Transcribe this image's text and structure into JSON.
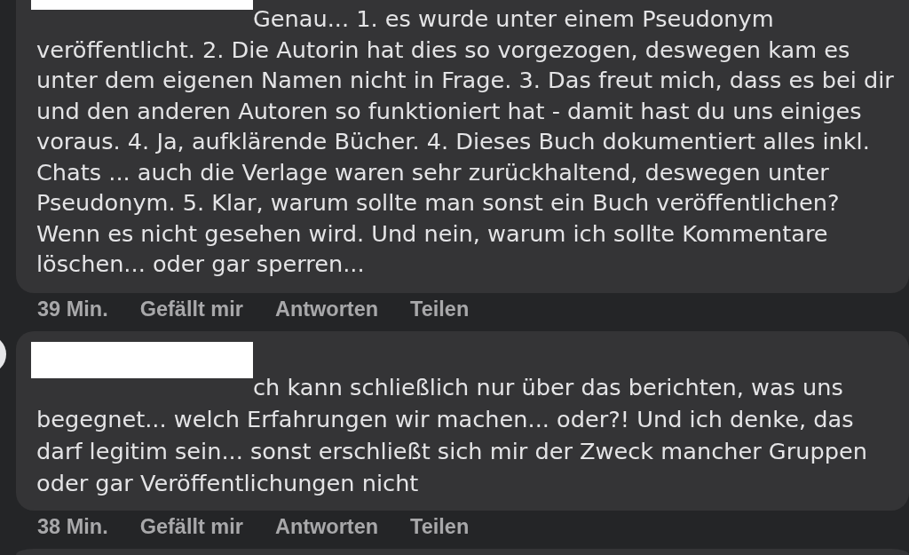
{
  "comments": [
    {
      "avatar": false,
      "text": "Genau... 1. es wurde unter einem Pseudonym veröffentlicht. 2. Die Autorin hat dies so vorgezogen, deswegen kam es unter dem eigenen Namen nicht in Frage. 3. Das freut mich, dass es bei dir und den anderen Autoren so funktioniert hat - damit hast du uns einiges voraus. 4. Ja, aufklärende Bücher. 4. Dieses Buch dokumentiert alles inkl. Chats ... auch die Verlage waren sehr zurückhaltend, deswegen unter Pseudonym. 5. Klar, warum sollte man sonst ein Buch veröffentlichen? Wenn es nicht gesehen wird. Und nein, warum ich sollte Kommentare löschen... oder gar sperren...",
      "time": "39 Min.",
      "actions": [
        "Gefällt mir",
        "Antworten",
        "Teilen"
      ]
    },
    {
      "avatar": true,
      "text": "ch kann schließlich nur über das berichten, was uns begegnet... welch Erfahrungen wir machen... oder?! Und ich denke, das darf legitim sein... sonst erschließt sich mir der Zweck mancher Gruppen oder gar Veröffentlichungen nicht",
      "time": "38 Min.",
      "actions": [
        "Gefällt mir",
        "Antworten",
        "Teilen"
      ]
    }
  ]
}
